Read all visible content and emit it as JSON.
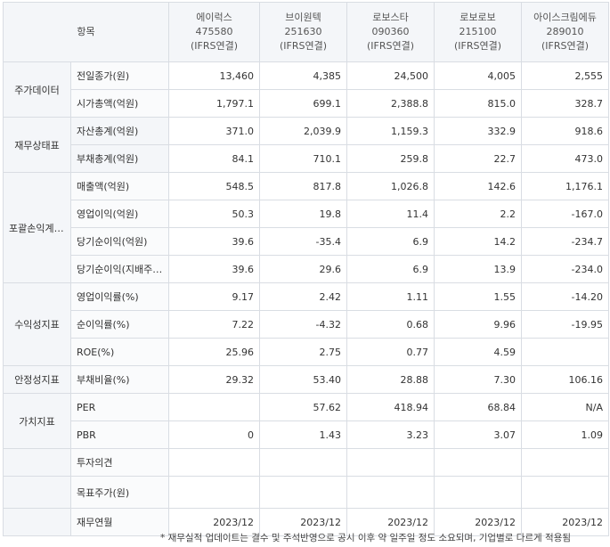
{
  "header": {
    "corner": "항목",
    "companies": [
      {
        "name": "에이럭스",
        "code": "475580",
        "basis": "(IFRS연결)"
      },
      {
        "name": "브이원텍",
        "code": "251630",
        "basis": "(IFRS연결)"
      },
      {
        "name": "로보스타",
        "code": "090360",
        "basis": "(IFRS연결)"
      },
      {
        "name": "로보로보",
        "code": "215100",
        "basis": "(IFRS연결)"
      },
      {
        "name": "아이스크림에듀",
        "code": "289010",
        "basis": "(IFRS연결)"
      }
    ]
  },
  "groups": {
    "stock": "주가데이터",
    "finance": "재무상태표",
    "income": "포괄손익계산서",
    "profit": "수익성지표",
    "stability": "안정성지표",
    "value": "가치지표"
  },
  "rows": [
    {
      "label": "전일종가(원)",
      "values": [
        "13,460",
        "4,385",
        "24,500",
        "4,005",
        "2,555"
      ]
    },
    {
      "label": "시가총액(억원)",
      "values": [
        "1,797.1",
        "699.1",
        "2,388.8",
        "815.0",
        "328.7"
      ]
    },
    {
      "label": "자산총계(억원)",
      "values": [
        "371.0",
        "2,039.9",
        "1,159.3",
        "332.9",
        "918.6"
      ]
    },
    {
      "label": "부채총계(억원)",
      "values": [
        "84.1",
        "710.1",
        "259.8",
        "22.7",
        "473.0"
      ]
    },
    {
      "label": "매출액(억원)",
      "values": [
        "548.5",
        "817.8",
        "1,026.8",
        "142.6",
        "1,176.1"
      ]
    },
    {
      "label": "영업이익(억원)",
      "values": [
        "50.3",
        "19.8",
        "11.4",
        "2.2",
        "-167.0"
      ]
    },
    {
      "label": "당기순이익(억원)",
      "values": [
        "39.6",
        "-35.4",
        "6.9",
        "14.2",
        "-234.7"
      ]
    },
    {
      "label": "당기순이익(지배주주)",
      "values": [
        "39.6",
        "29.6",
        "6.9",
        "13.9",
        "-234.0"
      ]
    },
    {
      "label": "영업이익률(%)",
      "values": [
        "9.17",
        "2.42",
        "1.11",
        "1.55",
        "-14.20"
      ]
    },
    {
      "label": "순이익률(%)",
      "values": [
        "7.22",
        "-4.32",
        "0.68",
        "9.96",
        "-19.95"
      ]
    },
    {
      "label": "ROE(%)",
      "values": [
        "25.96",
        "2.75",
        "0.77",
        "4.59",
        ""
      ]
    },
    {
      "label": "부채비율(%)",
      "values": [
        "29.32",
        "53.40",
        "28.88",
        "7.30",
        "106.16"
      ]
    },
    {
      "label": "PER",
      "values": [
        "",
        "57.62",
        "418.94",
        "68.84",
        "N/A"
      ]
    },
    {
      "label": "PBR",
      "values": [
        "0",
        "1.43",
        "3.23",
        "3.07",
        "1.09"
      ]
    },
    {
      "label": "투자의견",
      "values": [
        "",
        "",
        "",
        "",
        ""
      ]
    },
    {
      "label": "목표주가(원)",
      "values": [
        "",
        "",
        "",
        "",
        ""
      ]
    },
    {
      "label": "재무연월",
      "values": [
        "2023/12",
        "2023/12",
        "2023/12",
        "2023/12",
        "2023/12"
      ]
    }
  ],
  "footnote": "* 재무실적 업데이트는 결수 및 주석반영으로 공시 이후 약 일주일 정도 소요되며, 기업별로 다르게 적용됨"
}
